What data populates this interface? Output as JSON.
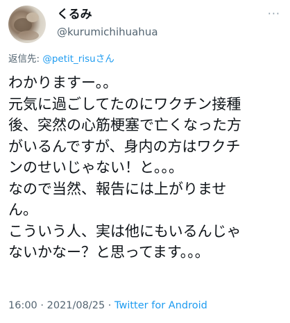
{
  "author": {
    "display_name": "くるみ",
    "username": "@kurumichihuahua"
  },
  "menu_icon": "more-horizontal-icon",
  "reply_to": {
    "prefix": "返信先: ",
    "mention": "@petit_risu",
    "suffix": "さん"
  },
  "tweet": {
    "lines": [
      "わかりますー。。",
      "元気に過ごしてたのにワクチン接種",
      "後、突然の心筋梗塞で亡くなった方",
      "がいるんですが、身内の方はワクチ",
      "ンのせいじゃない！と。。。",
      "なので当然、報告には上がりませ",
      "ん。",
      "こういう人、実は他にもいるんじゃ",
      "ないかなー？と思ってます。。。"
    ]
  },
  "meta": {
    "time": "16:00",
    "date": "2021/08/25",
    "separator": " · ",
    "source": "Twitter for Android"
  },
  "colors": {
    "text": "#0f1419",
    "secondary": "#536471",
    "link": "#1d9bf0",
    "background": "#ffffff"
  }
}
